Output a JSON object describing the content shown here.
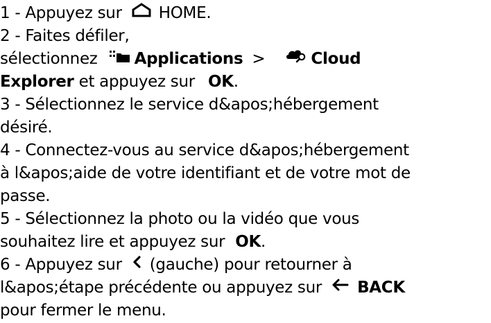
{
  "steps": {
    "s1": {
      "prefix": "1 -  Appuyez sur ",
      "home_label": "HOME",
      "suffix": "."
    },
    "s2": {
      "line1": "2 -  Faites défiler,",
      "prefix": "sélectionnez ",
      "applications_label": "Applications",
      "separator": " > ",
      "cloud_label": "Cloud",
      "explorer_label": "Explorer",
      "middle": " et appuyez sur ",
      "ok_label": "OK",
      "suffix": "."
    },
    "s3": {
      "line1": "3 -  Sélectionnez le service d&apos;hébergement",
      "line2": "désiré."
    },
    "s4": {
      "line1": "4 -  Connectez-vous au service d&apos;hébergement",
      "line2": "à l&apos;aide de votre identifiant et de votre mot de",
      "line3": "passe."
    },
    "s5": {
      "line1": "5 -  Sélectionnez la photo ou la vidéo que vous",
      "prefix": "souhaitez lire et appuyez sur ",
      "ok_label": "OK",
      "suffix": "."
    },
    "s6": {
      "prefix": "6 -  Appuyez sur ",
      "after_left": " (gauche) pour retourner à",
      "line2_prefix": "l&apos;étape précédente ou appuyez sur ",
      "back_label": "BACK",
      "line3": "pour fermer le menu."
    }
  },
  "icons": {
    "home": "home-icon",
    "applications": "applications-icon",
    "cloud": "cloud-search-icon",
    "left": "chevron-left-icon",
    "back": "arrow-left-icon"
  }
}
